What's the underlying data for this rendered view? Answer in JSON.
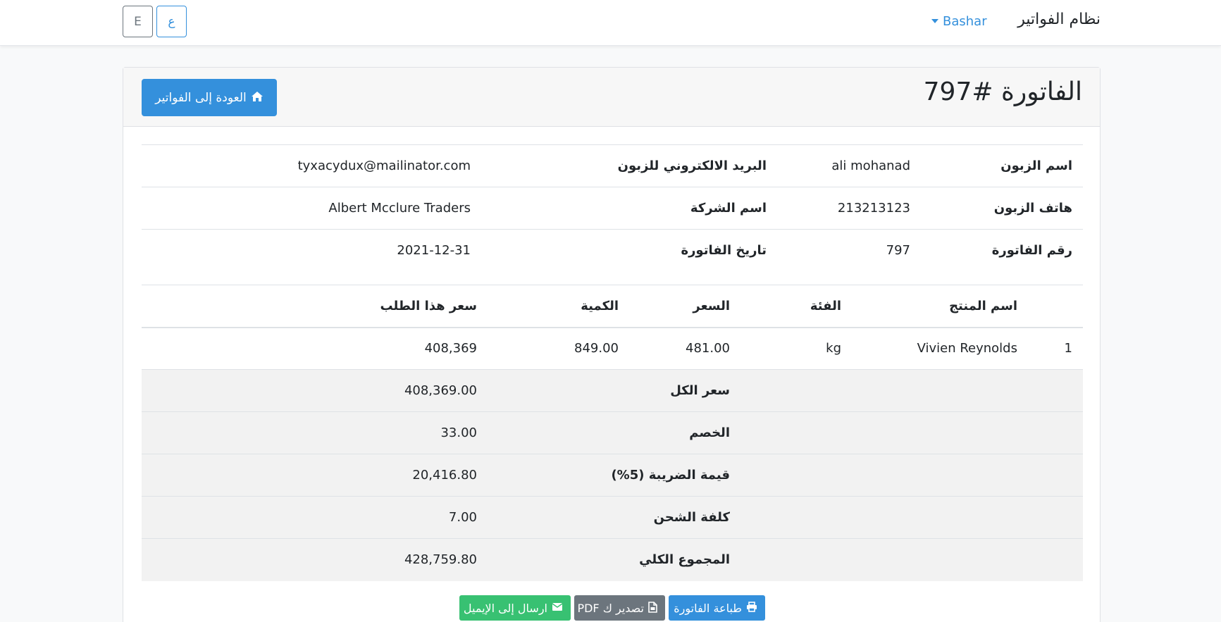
{
  "navbar": {
    "brand": "نظام الفواتير",
    "user_name": "Bashar",
    "lang_en": "E",
    "lang_ar": "ع"
  },
  "header": {
    "title": "الفاتورة #797",
    "back_button": "العودة إلى الفواتير"
  },
  "info": {
    "rows": [
      {
        "label_a": "اسم الزبون",
        "value_a": "ali mohanad",
        "label_b": "البريد الالكتروني للزبون",
        "value_b": "tyxacydux@mailinator.com"
      },
      {
        "label_a": "هاتف الزبون",
        "value_a": "213213123",
        "label_b": "اسم الشركة",
        "value_b": "Albert Mcclure Traders"
      },
      {
        "label_a": "رقم الفاتورة",
        "value_a": "797",
        "label_b": "تاريخ الفاتورة",
        "value_b": "2021-12-31"
      }
    ]
  },
  "items": {
    "headers": [
      "",
      "اسم المنتج",
      "الفئة",
      "السعر",
      "الكمية",
      "سعر هذا الطلب"
    ],
    "rows": [
      {
        "index": "1",
        "product": "Vivien Reynolds",
        "unit": "kg",
        "price": "481.00",
        "quantity": "849.00",
        "row_total": "408,369"
      }
    ],
    "summary": [
      {
        "label": "سعر الكل",
        "value": "408,369.00"
      },
      {
        "label": "الخصم",
        "value": "33.00"
      },
      {
        "label": "قيمة الضريبة (5%)",
        "value": "20,416.80"
      },
      {
        "label": "كلفة الشحن",
        "value": "7.00"
      },
      {
        "label": "المجموع الكلي",
        "value": "428,759.80"
      }
    ]
  },
  "actions": {
    "print": "طباعة الفاتورة",
    "pdf": "تصدير ك PDF",
    "email": "ارسال إلى الإيميل"
  },
  "colors": {
    "primary": "#3490dc",
    "secondary": "#6c757d",
    "success": "#38c172"
  }
}
